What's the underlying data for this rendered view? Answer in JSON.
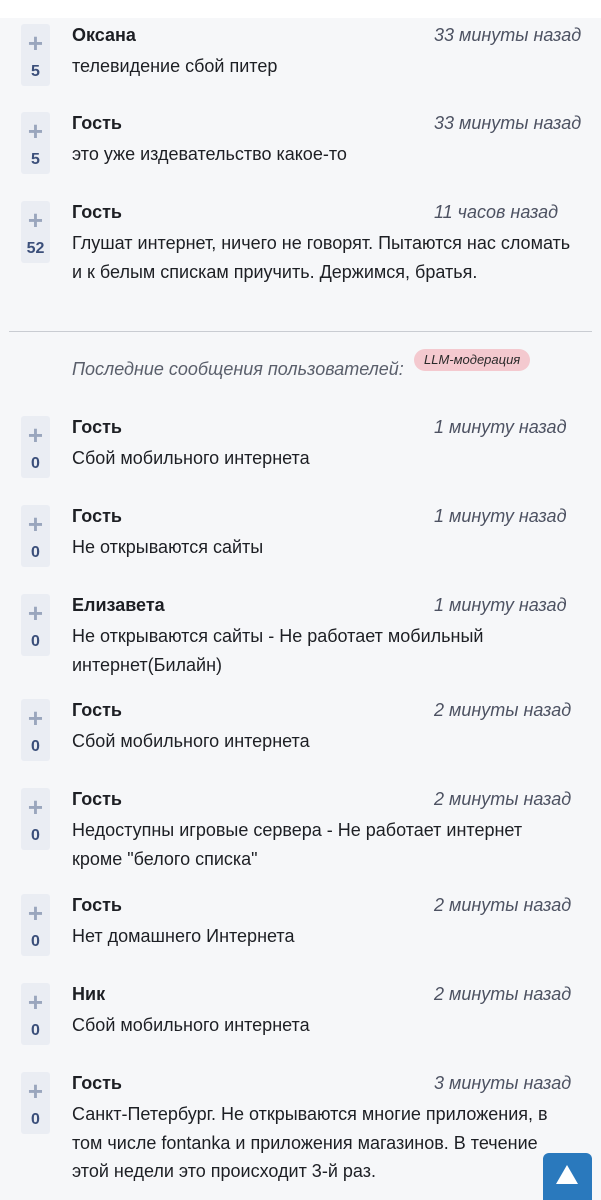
{
  "comments_top": [
    {
      "author": "Оксана",
      "time": "33 минуты назад",
      "votes": "5",
      "text": "телевидение сбой питер"
    },
    {
      "author": "Гость",
      "time": "33 минуты назад",
      "votes": "5",
      "text": "это уже издевательство какое-то"
    },
    {
      "author": "Гость",
      "time": "11 часов назад",
      "votes": "52",
      "text": "Глушат интернет, ничего не говорят. Пытаются нас сломать и к белым спискам приучить. Держимся, братья."
    }
  ],
  "section": {
    "title": "Последние сообщения пользователей:",
    "badge": "LLM-модерация"
  },
  "comments_recent": [
    {
      "author": "Гость",
      "time": "1 минуту назад",
      "votes": "0",
      "text": "Сбой мобильного интернета"
    },
    {
      "author": "Гость",
      "time": "1 минуту назад",
      "votes": "0",
      "text": "Не открываются сайты"
    },
    {
      "author": "Елизавета",
      "time": "1 минуту назад",
      "votes": "0",
      "text": "Не открываются сайты - Не работает мобильный интернет(Билайн)"
    },
    {
      "author": "Гость",
      "time": "2 минуты назад",
      "votes": "0",
      "text": "Сбой мобильного интернета"
    },
    {
      "author": "Гость",
      "time": "2 минуты назад",
      "votes": "0",
      "text": "Недоступны игровые сервера - Не работает интернет кроме \"белого списка\""
    },
    {
      "author": "Гость",
      "time": "2 минуты назад",
      "votes": "0",
      "text": "Нет домашнего Интернета"
    },
    {
      "author": "Ник",
      "time": "2 минуты назад",
      "votes": "0",
      "text": "Сбой мобильного интернета"
    },
    {
      "author": "Гость",
      "time": "3 минуты назад",
      "votes": "0",
      "text": "Санкт-Петербург. Не открываются многие приложения, в том числе fontanka и приложения магазинов. В течение этой недели это происходит 3-й раз."
    }
  ],
  "icons": {
    "upvote": "plus-icon",
    "scroll_top": "arrow-up-icon"
  },
  "colors": {
    "accent": "#2a79bd",
    "badge_bg": "#f4c9cf",
    "vote_count": "#3b4f7a"
  }
}
